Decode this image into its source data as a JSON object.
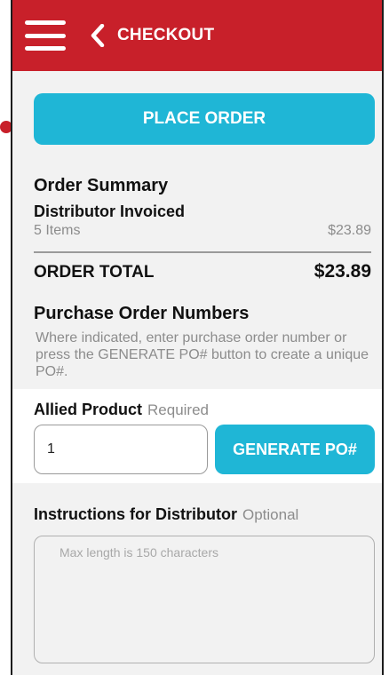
{
  "header": {
    "title": "CHECKOUT",
    "menu_icon": "hamburger-menu-icon",
    "back_icon": "chevron-left-icon",
    "bg_color": "#c8202a"
  },
  "actions": {
    "place_order_label": "PLACE ORDER",
    "accent_color": "#1fb6d6"
  },
  "order_summary": {
    "title": "Order Summary",
    "distributor": "Distributor Invoiced",
    "items_count": "5 Items",
    "items_price": "$23.89",
    "total_label": "ORDER TOTAL",
    "total_value": "$23.89"
  },
  "purchase_orders": {
    "title": "Purchase Order Numbers",
    "description": "Where indicated, enter purchase order number or press the GENERATE PO# button to create a unique PO#."
  },
  "allied_product": {
    "label": "Allied Product",
    "requirement": "Required",
    "po_value": "1",
    "generate_label": "GENERATE PO#"
  },
  "instructions": {
    "label": "Instructions for Distributor",
    "requirement": "Optional",
    "placeholder": "Max length is 150 characters"
  }
}
